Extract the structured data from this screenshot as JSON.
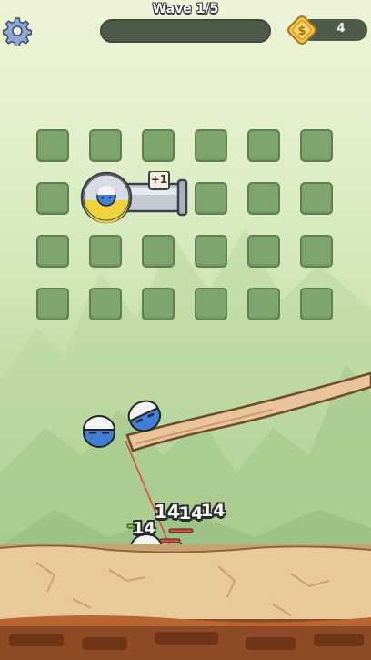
{
  "hud": {
    "wave_label": "Wave 1/5",
    "wave_progress": 0.0,
    "coin_count": "4"
  },
  "tank": {
    "bonus_label": "+1"
  },
  "damage_numbers": {
    "d1": "14",
    "d2": "14",
    "d3": "14",
    "d4": "14",
    "d5": "14"
  },
  "enemy_label": "14",
  "colors": {
    "slot": "#7fa56f",
    "hud_bar": "#4f5b4a",
    "coin": "#f2b233",
    "player_blue": "#3f7fd8",
    "enemy_red": "#e0483a",
    "ground": "#e9c99a"
  },
  "icons": [
    "gear-icon",
    "coin-icon"
  ]
}
